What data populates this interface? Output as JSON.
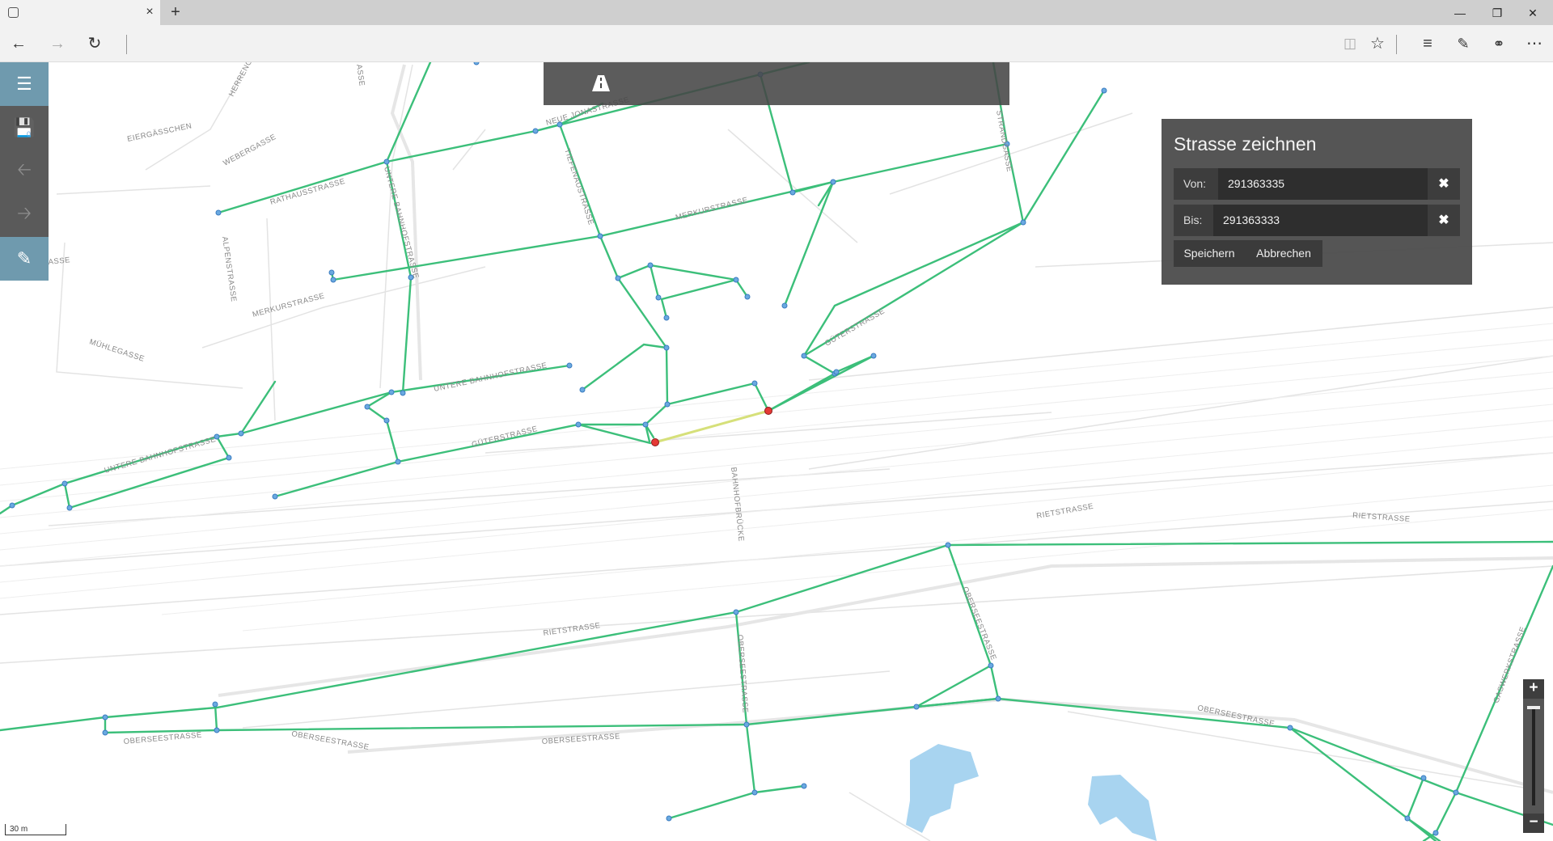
{
  "browser": {
    "tab_close": "×",
    "new_tab": "+",
    "window_controls": [
      "minimize-icon",
      "restore-icon",
      "close-icon"
    ]
  },
  "toolbar_icons": [
    "back-arrow-icon",
    "forward-arrow-icon",
    "refresh-icon",
    "reading-view-icon",
    "favorite-star-icon",
    "hub-icon",
    "web-note-icon",
    "share-icon",
    "more-icon"
  ],
  "left_toolbar": {
    "save_badge": "0",
    "items": [
      "menu-icon",
      "save-icon",
      "undo-icon",
      "redo-icon",
      "edit-pencil-icon"
    ]
  },
  "draw_panel": {
    "title": "Strasse zeichnen",
    "from_label": "Von:",
    "from_value": "291363335",
    "to_label": "Bis:",
    "to_value": "291363333",
    "clear_symbol": "✖",
    "save_label": "Speichern",
    "cancel_label": "Abbrechen"
  },
  "zoom": {
    "in_label": "+",
    "out_label": "−"
  },
  "scale": {
    "label": "30 m"
  },
  "map_labels": [
    "EIERGÄSSCHEN",
    "HERRENG",
    "WEBERGASSE",
    "RATHAUSSTRASSE",
    "ALPENSTRASSE",
    "ASSE",
    "MERKURSTRASSE",
    "MÜHLEGASSE",
    "UNTERE BAHNHOFSTRASSE",
    "UNTERE BAHNHOFSTRASSE",
    "UNTERE BAHNHOFSTRASSE",
    "NEUE JONASTRASSE",
    "TIEFENAUSTRASSE",
    "MERKURSTRASSE",
    "GÜTERSTRASSE",
    "GÜTERSTRASSE",
    "BAHNHOFBRÜCKE",
    "RIETSTRASSE",
    "RIETSTRASSE",
    "RIETSTRASSE",
    "OBERSEESTRASSE",
    "OBERSEESTRASSE",
    "OBERSEESTRASSE",
    "OBERSEESTRASSE",
    "OBERSEESTRASSE",
    "OBERSEESTRASSE",
    "GASWERKSTRASSE",
    "STRANDGASSE",
    "STRANDGASSE",
    "ASSE"
  ],
  "colors": {
    "network_line": "#3cbf7a",
    "node_fill": "#6aa9e0",
    "selected_node": "#e53935",
    "new_segment": "#d6e07a",
    "water": "#a8d4f0",
    "panel_bg": "#4a4a4a",
    "toolbar_blue": "#6f9aae"
  }
}
